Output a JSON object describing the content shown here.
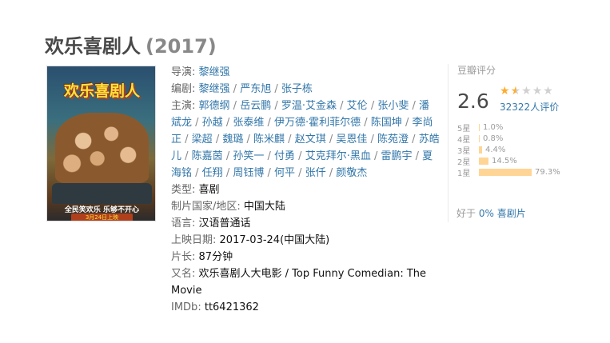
{
  "movie": {
    "title": "欢乐喜剧人",
    "year": "(2017)"
  },
  "poster": {
    "title": "欢乐喜剧人",
    "tagline": "全民笑欢乐 乐够不开心",
    "date": "3月24日上映"
  },
  "info": {
    "director_label": "导演:",
    "directors": [
      "黎继强"
    ],
    "writer_label": "编剧:",
    "writers": [
      "黎继强",
      "严东旭",
      "张子栋"
    ],
    "cast_label": "主演:",
    "cast": [
      "郭德纲",
      "岳云鹏",
      "罗温·艾金森",
      "艾伦",
      "张小斐",
      "潘斌龙",
      "孙越",
      "张泰维",
      "伊万德·霍利菲尔德",
      "陈国坤",
      "李尚正",
      "梁超",
      "魏璐",
      "陈米麒",
      "赵文琪",
      "吴恩佳",
      "陈苑澄",
      "苏皓儿",
      "陈嘉茵",
      "孙笑一",
      "付勇",
      "艾克拜尔·黑血",
      "雷鹏宇",
      "夏海铭",
      "任翔",
      "周钰博",
      "何平",
      "张仟",
      "颜敬杰"
    ],
    "genre_label": "类型:",
    "genre": "喜剧",
    "country_label": "制片国家/地区:",
    "country": "中国大陆",
    "language_label": "语言:",
    "language": "汉语普通话",
    "release_label": "上映日期:",
    "release": "2017-03-24(中国大陆)",
    "runtime_label": "片长:",
    "runtime": "87分钟",
    "aka_label": "又名:",
    "aka": "欢乐喜剧人大电影 / Top Funny Comedian: The Movie",
    "imdb_label": "IMDb:",
    "imdb": "tt6421362"
  },
  "rating": {
    "label": "豆瓣评分",
    "score": "2.6",
    "stars_value": 1.5,
    "votes": "32322",
    "votes_suffix": "人评价",
    "breakdown": [
      {
        "label": "5星",
        "pct": "1.0%",
        "value": 1.0
      },
      {
        "label": "4星",
        "pct": "0.8%",
        "value": 0.8
      },
      {
        "label": "3星",
        "pct": "4.4%",
        "value": 4.4
      },
      {
        "label": "2星",
        "pct": "14.5%",
        "value": 14.5
      },
      {
        "label": "1星",
        "pct": "79.3%",
        "value": 79.3
      }
    ],
    "better_prefix": "好于",
    "better_value": "0% 喜剧片"
  },
  "colors": {
    "link": "#3377aa",
    "star": "#ffac2d",
    "bar": "#ffd596"
  }
}
